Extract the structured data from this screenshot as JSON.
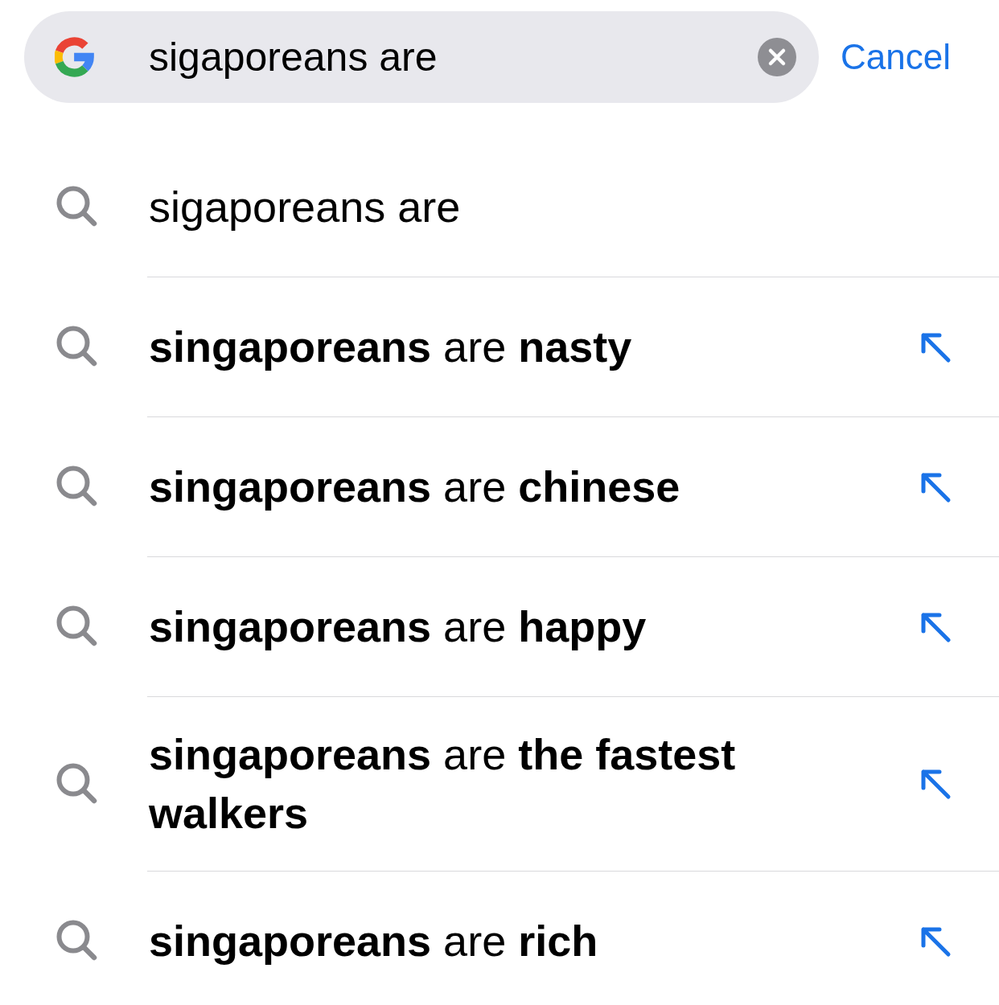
{
  "search_bar": {
    "value": "sigaporeans are"
  },
  "cancel_button": "Cancel",
  "suggestions": [
    {
      "kind": "query",
      "text": "sigaporeans are"
    },
    {
      "kind": "completion",
      "text": "**singaporeans** are **nasty**"
    },
    {
      "kind": "completion",
      "text": "**singaporeans** are **chinese**"
    },
    {
      "kind": "completion",
      "text": "**singaporeans** are **happy**"
    },
    {
      "kind": "completion",
      "text": "**singaporeans** are **the fastest walkers**"
    },
    {
      "kind": "completion",
      "text": "**singaporeans** are **rich**"
    }
  ]
}
